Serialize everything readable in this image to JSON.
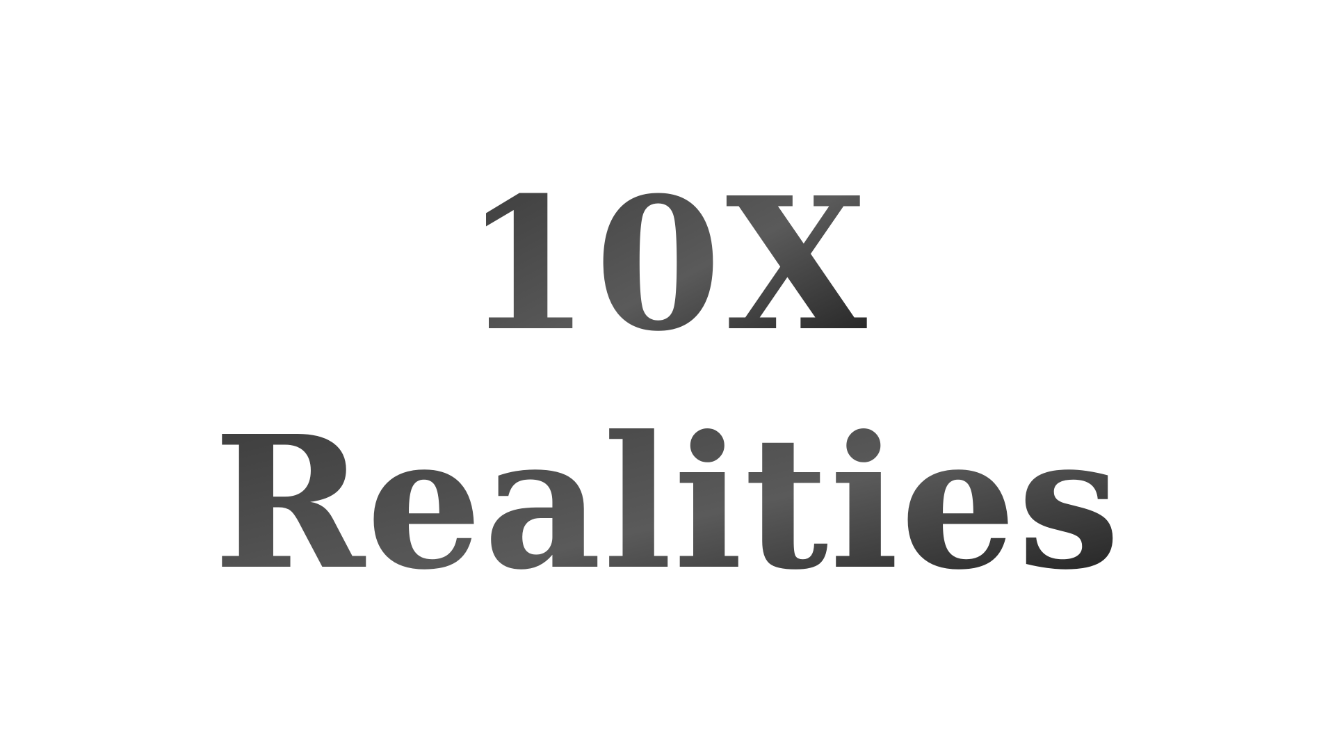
{
  "logo": {
    "line1": "10X",
    "line2": "Realities"
  },
  "colors": {
    "background": "#ffffff",
    "gradient_start": "#3a3a3a",
    "gradient_mid": "#5a5a5a",
    "gradient_end": "#1a1a1a"
  }
}
